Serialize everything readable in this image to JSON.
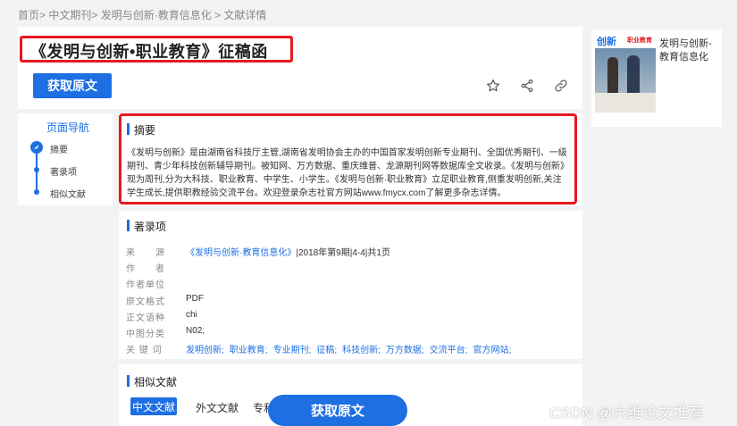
{
  "breadcrumb": {
    "home": "首页",
    "sep1": "> ",
    "journals": "中文期刊",
    "sep2": "> ",
    "journal": "发明与创新·教育信息化",
    "sep3": " > ",
    "current": "文献详情"
  },
  "article": {
    "title": "《发明与创新•职业教育》征稿函",
    "get_button": "获取原文"
  },
  "actions": {
    "favorite": "star-icon",
    "share": "share-icon",
    "link": "link-icon"
  },
  "cover": {
    "journal_name": "发明与创新-教育信息化",
    "cover_logo": "创新",
    "cover_logo2": "职业教育"
  },
  "nav": {
    "title": "页面导航",
    "items": [
      "摘要",
      "著录项",
      "相似文献"
    ]
  },
  "abstract": {
    "heading": "摘要",
    "text": "《发明与创新》是由湖南省科技厅主管,湖南省发明协会主办的中国首家发明创新专业期刊、全国优秀期刊、一级期刊、青少年科技创新辅导期刊。被知网、万方数据、重庆维普、龙源期刊网等数据库全文收录。《发明与创新》现为周刊,分为大科技、职业教育、中学生、小学生。《发明与创新·职业教育》立足职业教育,侧重发明创新,关注学生成长,提供职教经验交流平台。欢迎登录杂志社官方网站www.fmycx.com了解更多杂志详情。"
  },
  "bibliography": {
    "heading": "著录项",
    "source_label": "来　　源",
    "source_link": "《发明与创新·教育信息化》",
    "source_rest": "|2018年第9期|4-4|共1页",
    "author_label": "作　　者",
    "unit_label": "作者单位",
    "format_label": "原文格式",
    "format_value": "PDF",
    "lang_label": "正文语种",
    "lang_value": "chi",
    "class_label": "中图分类",
    "class_value": "N02;",
    "kw_label": "关 键 词",
    "keywords": [
      "发明创新;",
      "职业教育;",
      "专业期刊;",
      "征稿;",
      "科技创新;",
      "万方数据;",
      "交流平台;",
      "官方网站;"
    ]
  },
  "similar": {
    "heading": "相似文献",
    "tabs": [
      "中文文献",
      "外文文献",
      "专利"
    ]
  },
  "floating_button": "获取原文",
  "watermark": "CSDN @六维论文推荐",
  "colors": {
    "accent": "#1e6fe2",
    "highlight": "#e8191f"
  }
}
